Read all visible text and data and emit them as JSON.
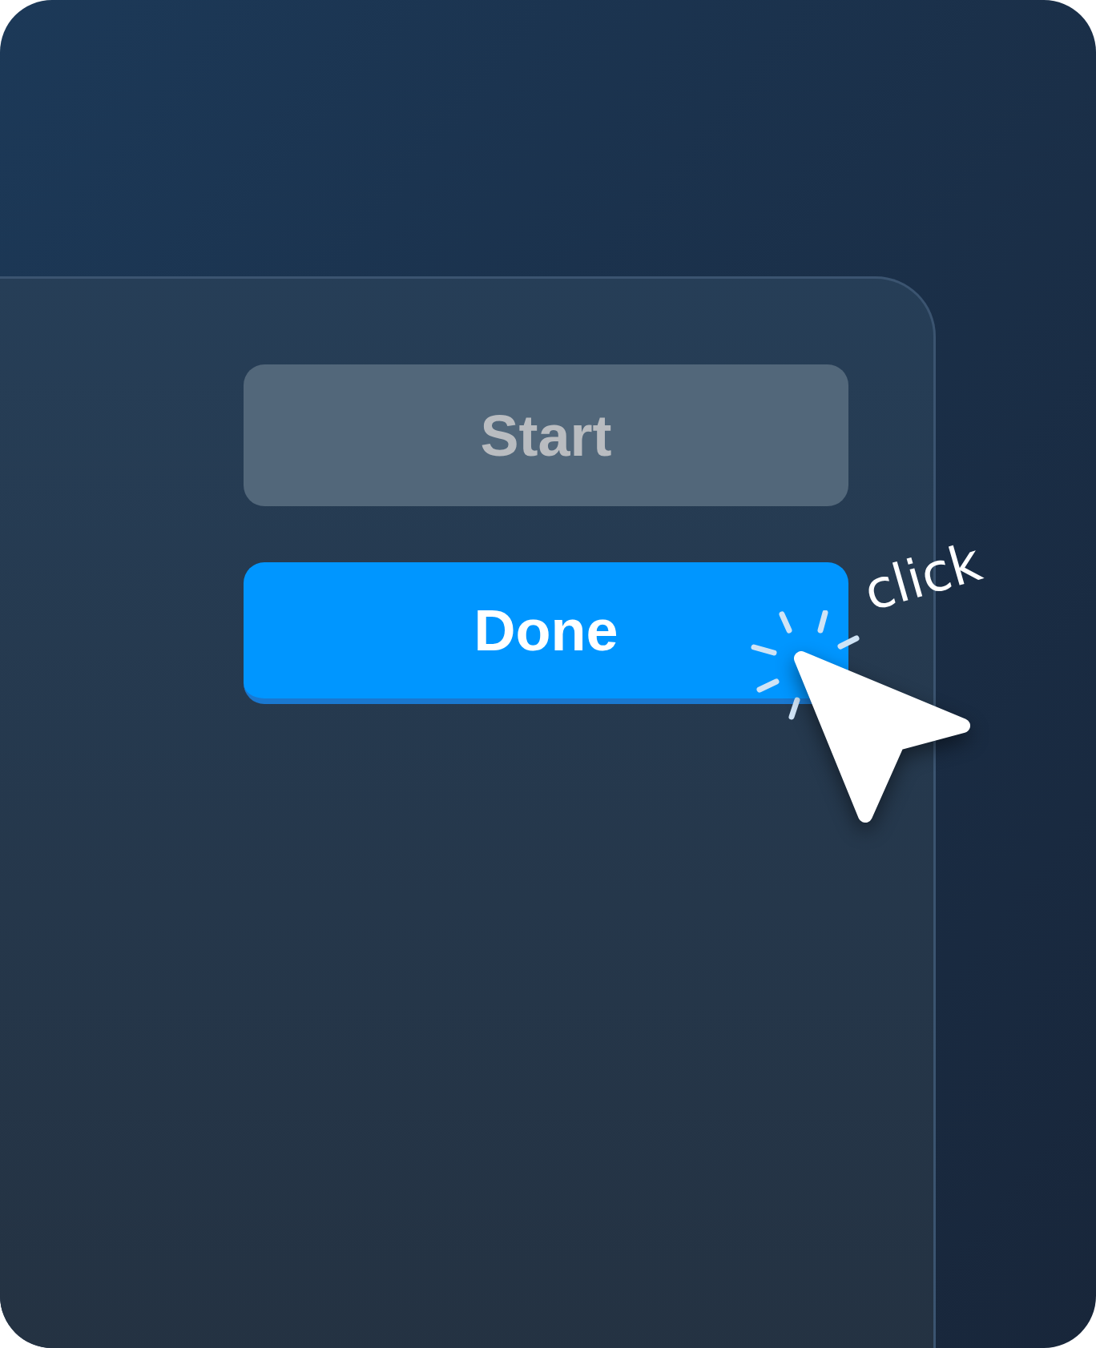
{
  "buttons": [
    {
      "label": "Start",
      "disabled": true
    },
    {
      "label": "Done",
      "disabled": false
    }
  ],
  "annotation": "click"
}
